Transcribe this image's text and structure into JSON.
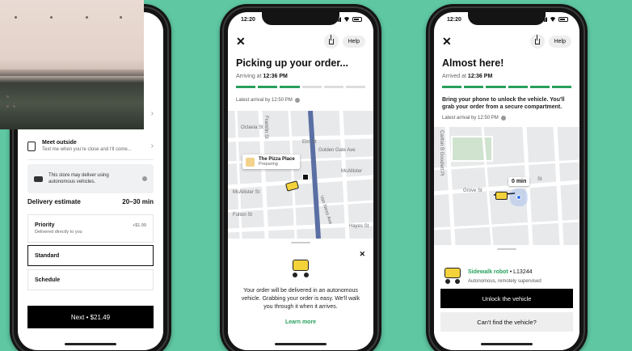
{
  "status": {
    "time": "12:20"
  },
  "screen1": {
    "meet_outside": {
      "title": "Meet outside",
      "subtitle": "Text me when you're close and I'll come..."
    },
    "notice": "This store may deliver using autonomous vehicles.",
    "delivery_estimate": {
      "label": "Delivery estimate",
      "value": "20–30 min"
    },
    "options": [
      {
        "title": "Priority",
        "subtitle": "Delivered directly to you",
        "price": "+$1.99"
      },
      {
        "title": "Standard"
      },
      {
        "title": "Schedule"
      }
    ],
    "next_button": "Next • $21.49"
  },
  "screen2": {
    "help": "Help",
    "title": "Picking up your order...",
    "arriving_prefix": "Arriving at",
    "arriving_time": "12:36 PM",
    "progress": {
      "segments": 6,
      "filled": 3
    },
    "latest_arrival": "Latest arrival by 12:50 PM",
    "map": {
      "place_name": "The Pizza Place",
      "place_status": "Preparing",
      "streets": [
        "Franklin St",
        "Gough St",
        "Laguna St",
        "Octavia St",
        "Elm St",
        "Golden Gate Ave",
        "McAllister St",
        "Fulton St",
        "Hayes St",
        "Grove St",
        "Van Ness Ave",
        "Ivy St",
        "McAllister"
      ]
    },
    "sheet_text": "Your order will be delivered in an autonomous vehicle. Grabbing your order is easy. We'll walk you through it when it arrives.",
    "learn_more": "Learn more"
  },
  "screen3": {
    "help": "Help",
    "title": "Almost here!",
    "arriving_prefix": "Arrived at",
    "arriving_time": "12:36 PM",
    "progress": {
      "segments": 6,
      "filled": 6
    },
    "description": "Bring your phone to unlock the vehicle. You'll grab your order from a secure compartment.",
    "latest_arrival": "Latest arrival by 12:50 PM",
    "map": {
      "eta": "0 min",
      "streets": [
        "Carlton B Goodlett Pl",
        "Grove St",
        "Polk St",
        "Larkin St",
        "St"
      ]
    },
    "robot_name": "Sidewalk robot",
    "robot_id": "• L13244",
    "robot_sub": "Autonomous, remotely supervised",
    "unlock_button": "Unlock the vehicle",
    "cant_find_button": "Can't find the vehicle?"
  },
  "colors": {
    "background": "#5fc8a3",
    "accent_green": "#27a05b",
    "robot_yellow": "#f4d23a"
  }
}
